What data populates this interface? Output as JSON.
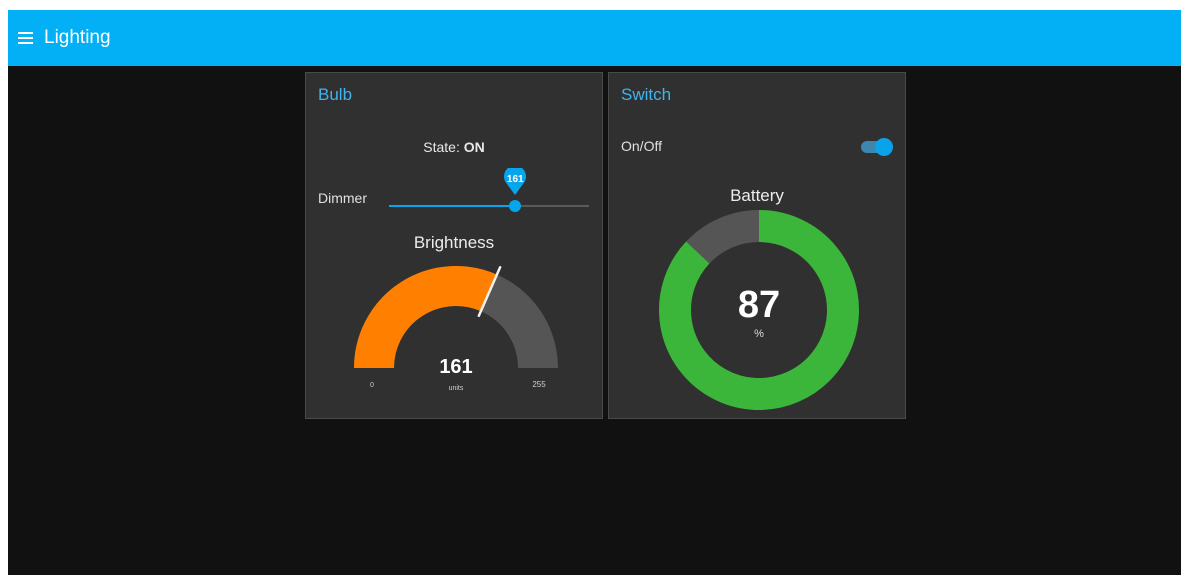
{
  "header": {
    "title": "Lighting",
    "menu_icon": "menu-icon"
  },
  "colors": {
    "header": "#03b0f6",
    "accent": "#07a6ec",
    "card_title": "#3fb4f0",
    "gauge_fill": "#ff8000",
    "gauge_empty": "#555555",
    "donut_fill": "#3cb53b",
    "donut_empty": "#555555"
  },
  "bulb": {
    "title": "Bulb",
    "state_label": "State:",
    "state_value": "ON",
    "dimmer_label": "Dimmer",
    "dimmer_value": "161",
    "dimmer_min": 0,
    "dimmer_max": 255,
    "gauge": {
      "title": "Brightness",
      "value": "161",
      "units": "units",
      "min": "0",
      "max": "255"
    }
  },
  "switch": {
    "title": "Switch",
    "onoff_label": "On/Off",
    "onoff_state": "on",
    "battery": {
      "title": "Battery",
      "value": "87",
      "units": "%"
    }
  }
}
